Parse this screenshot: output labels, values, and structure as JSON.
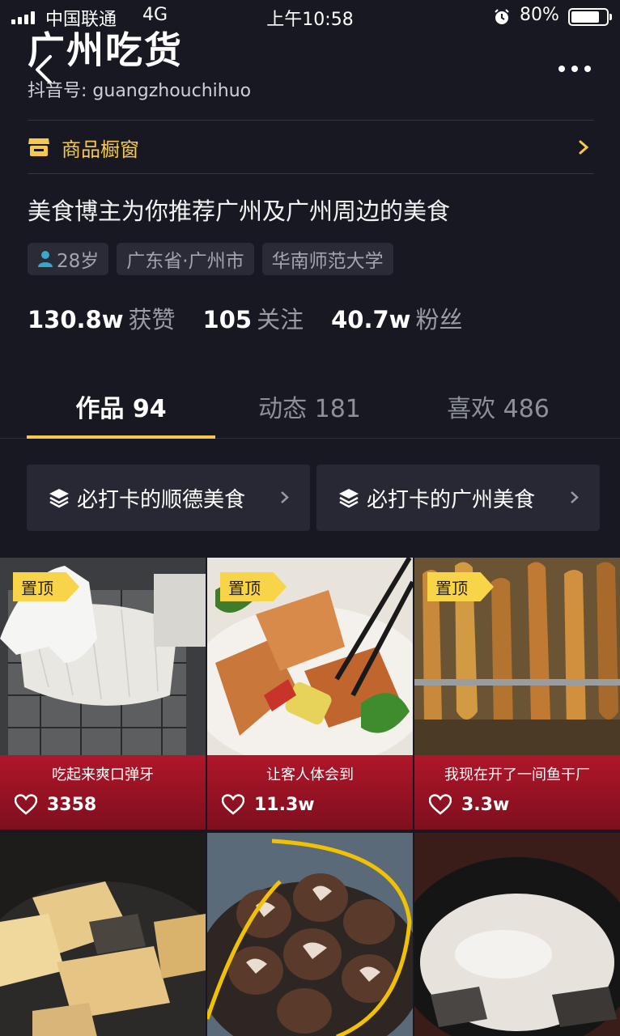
{
  "status_bar": {
    "carrier": "中国联通",
    "network": "4G",
    "time": "上午10:58",
    "battery": "80%",
    "battery_level": 0.8
  },
  "header": {
    "name": "广州吃货",
    "douyin_id": "抖音号: guangzhouchihuo",
    "icons": [
      "back-icon",
      "more-icon"
    ]
  },
  "showcase": {
    "label": "商品橱窗",
    "accent_color": "#f6c94c"
  },
  "bio": "美食博主为你推荐广州及广州周边的美食",
  "tags": {
    "age": "28岁",
    "location": "广东省·广州市",
    "school": "华南师范大学"
  },
  "stats": [
    {
      "value": "130.8w",
      "label": "获赞"
    },
    {
      "value": "105",
      "label": "关注"
    },
    {
      "value": "40.7w",
      "label": "粉丝"
    }
  ],
  "tabs": [
    {
      "label": "作品 94",
      "active": true
    },
    {
      "label": "动态 181",
      "active": false
    },
    {
      "label": "喜欢 486",
      "active": false
    }
  ],
  "collections": [
    {
      "label": "必打卡的顺德美食"
    },
    {
      "label": "必打卡的广州美食"
    }
  ],
  "videos": [
    {
      "pinned": "置顶",
      "caption": "吃起来爽口弹牙",
      "likes": "3358"
    },
    {
      "pinned": "置顶",
      "caption": "让客人体会到",
      "likes": "11.3w"
    },
    {
      "pinned": "置顶",
      "caption": "我现在开了一间鱼干厂",
      "likes": "3.3w"
    },
    {
      "pinned": "",
      "caption": "",
      "likes": ""
    },
    {
      "pinned": "",
      "caption": "",
      "likes": ""
    },
    {
      "pinned": "",
      "caption": "",
      "likes": ""
    }
  ],
  "colors": {
    "background": "#171822",
    "caption_bar": "#b0162a",
    "pin_badge": "#f8d548"
  }
}
